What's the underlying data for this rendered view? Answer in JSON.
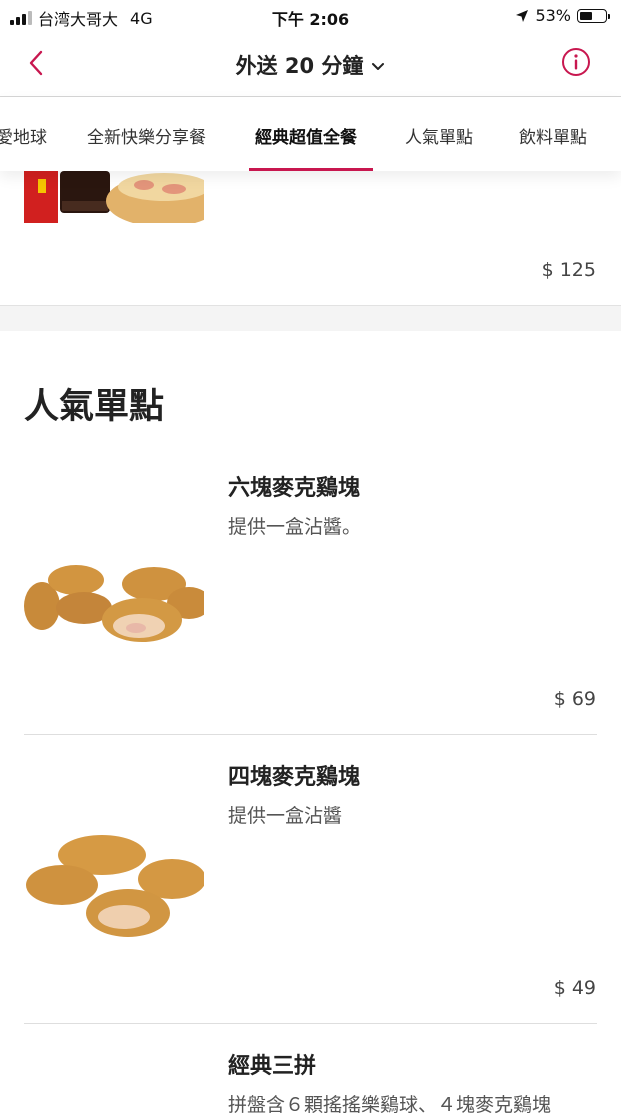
{
  "status_bar": {
    "carrier": "台湾大哥大",
    "network": "4G",
    "time": "下午 2:06",
    "battery": "53%",
    "battery_level": 0.53
  },
  "header": {
    "title": "外送 20 分鐘",
    "back_icon": "chevron-left-icon",
    "dropdown_icon": "chevron-down-icon",
    "info_icon": "info-circle-icon"
  },
  "tabs": [
    {
      "label": "愛地球"
    },
    {
      "label": "全新快樂分享餐"
    },
    {
      "label": "經典超值全餐",
      "active": true
    },
    {
      "label": "人氣單點"
    },
    {
      "label": "飲料單點"
    }
  ],
  "previous_item": {
    "price": "$ 125"
  },
  "section": {
    "title": "人氣單點"
  },
  "items": [
    {
      "name": "六塊麥克鷄塊",
      "desc": "提供一盒沾醬。",
      "price": "$ 69"
    },
    {
      "name": "四塊麥克鷄塊",
      "desc": "提供一盒沾醬",
      "price": "$ 49"
    },
    {
      "name": "經典三拼",
      "desc": "拼盤含６顆搖搖樂鷄球、４塊麥克鷄塊"
    }
  ],
  "colors": {
    "accent": "#c8174f",
    "text": "#222222",
    "muted": "#555555"
  }
}
